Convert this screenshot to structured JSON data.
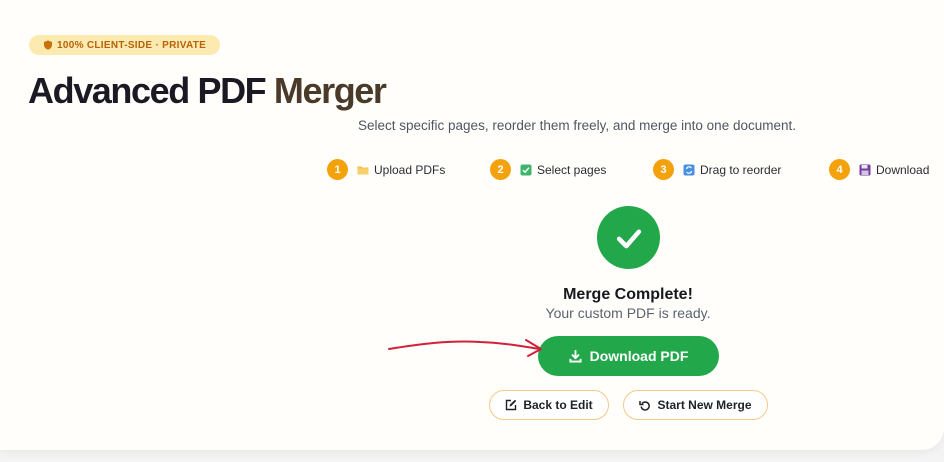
{
  "badge": {
    "text": "100% CLIENT-SIDE · PRIVATE",
    "icon": "shield-icon"
  },
  "header": {
    "title_part1": "Advanced PDF",
    "title_part2": "Merger",
    "subtitle": "Select specific pages, reorder them freely, and merge into one document."
  },
  "steps": [
    {
      "number": "1",
      "icon": "folder-icon",
      "label": "Upload PDFs"
    },
    {
      "number": "2",
      "icon": "checkbox-icon",
      "label": "Select pages"
    },
    {
      "number": "3",
      "icon": "reorder-icon",
      "label": "Drag to reorder"
    },
    {
      "number": "4",
      "icon": "floppy-disk-icon",
      "label": "Download"
    }
  ],
  "result": {
    "icon": "checkmark-icon",
    "title": "Merge Complete!",
    "subtitle": "Your custom PDF is ready."
  },
  "actions": {
    "download_label": "Download PDF",
    "back_label": "Back to Edit",
    "new_merge_label": "Start New Merge"
  },
  "colors": {
    "accent_green": "#22a84a",
    "step_orange": "#f3a20c",
    "badge_bg": "#fdeab0",
    "badge_text": "#b8620a",
    "annotation_red": "#d3203a"
  }
}
